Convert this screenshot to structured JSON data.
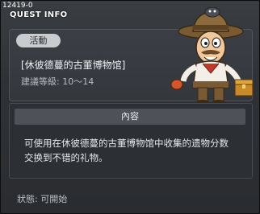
{
  "window": {
    "quest_id": "12419-0",
    "title": "QUEST INFO"
  },
  "quest": {
    "tag": "活動",
    "name": "[休彼德蔓的古董博物馆]",
    "level_label": "建議等級: 10～14",
    "mascot_icon": "explorer-mascot-icon"
  },
  "content": {
    "header": "內容",
    "description_line1": "可使用在休彼德蔓的古董博物馆中收集的遗物分数",
    "description_line2": "交换到不错的礼物。"
  },
  "status": {
    "text": "狀態:  可開始"
  },
  "colors": {
    "background": "#2e3135",
    "panel": "#3b3f45",
    "header_bar": "#4e5258",
    "tag_bg": "#c9cbce",
    "text_primary": "#e6e8eb"
  }
}
